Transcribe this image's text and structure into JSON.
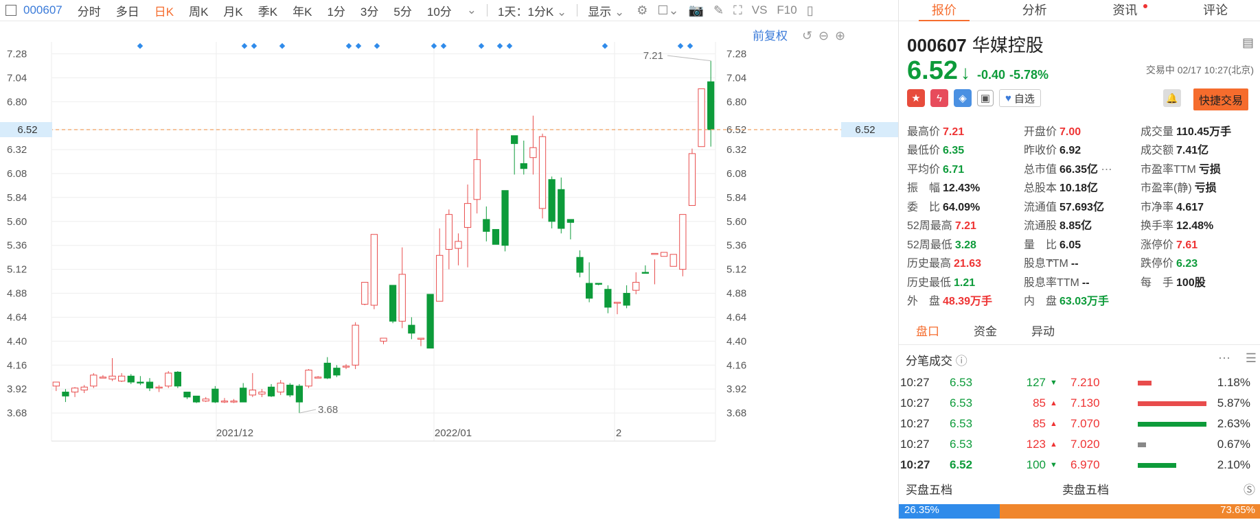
{
  "toolbar": {
    "code": "000607",
    "items": [
      "分时",
      "多日",
      "日K",
      "周K",
      "月K",
      "季K",
      "年K",
      "1分",
      "3分",
      "5分",
      "10分"
    ],
    "active": "日K",
    "period_select": "1天：1分K",
    "display_label": "显示",
    "f10": "F10"
  },
  "chart": {
    "restore_label": "前复权",
    "current_price_label": "6.52",
    "high_label": "7.21",
    "low_label": "3.68",
    "colors": {
      "up": "#e84c4c",
      "down": "#0d9b3a",
      "ref_line": "#f0a060",
      "grid": "#eeeeee",
      "marker": "#2f8bea"
    }
  },
  "chart_data": {
    "type": "candlestick",
    "ylim": [
      3.55,
      7.4
    ],
    "yticks": [
      "7.28",
      "7.04",
      "6.80",
      "6.52",
      "6.32",
      "6.08",
      "5.84",
      "5.60",
      "5.36",
      "5.12",
      "4.88",
      "4.64",
      "4.40",
      "4.16",
      "3.92",
      "3.68"
    ],
    "xtick_labels": [
      "2021/12",
      "2022/01",
      "2"
    ],
    "candles": [
      [
        3.95,
        3.99,
        3.9,
        3.98
      ],
      [
        3.89,
        3.85,
        3.79,
        3.92
      ],
      [
        3.89,
        3.93,
        3.84,
        3.94
      ],
      [
        3.91,
        3.94,
        3.88,
        3.96
      ],
      [
        3.95,
        4.06,
        3.93,
        4.08
      ],
      [
        4.04,
        4.04,
        4.03,
        4.06
      ],
      [
        4.02,
        4.05,
        4.0,
        4.23
      ],
      [
        4.0,
        4.05,
        3.99,
        4.08
      ],
      [
        4.05,
        3.99,
        3.97,
        4.07
      ],
      [
        3.99,
        3.98,
        3.96,
        4.05
      ],
      [
        3.99,
        3.93,
        3.9,
        4.03
      ],
      [
        3.93,
        3.94,
        3.89,
        3.96
      ],
      [
        3.95,
        4.08,
        3.93,
        4.1
      ],
      [
        4.09,
        3.95,
        3.93,
        4.1
      ],
      [
        3.89,
        3.84,
        3.82,
        3.89
      ],
      [
        3.85,
        3.79,
        3.78,
        3.85
      ],
      [
        3.8,
        3.82,
        3.79,
        3.84
      ],
      [
        3.92,
        3.79,
        3.78,
        3.95
      ],
      [
        3.8,
        3.8,
        3.78,
        3.83
      ],
      [
        3.79,
        3.8,
        3.78,
        3.82
      ],
      [
        3.93,
        3.79,
        3.79,
        3.98
      ],
      [
        3.86,
        3.91,
        3.84,
        4.08
      ],
      [
        3.87,
        3.89,
        3.84,
        3.92
      ],
      [
        3.94,
        3.85,
        3.84,
        3.97
      ],
      [
        3.89,
        3.98,
        3.86,
        4.01
      ],
      [
        3.96,
        3.86,
        3.84,
        3.98
      ],
      [
        3.95,
        3.79,
        3.68,
        3.97
      ],
      [
        3.95,
        4.11,
        3.93,
        4.12
      ],
      [
        4.03,
        4.04,
        4.03,
        4.05
      ],
      [
        4.18,
        4.03,
        4.02,
        4.24
      ],
      [
        4.13,
        4.06,
        4.04,
        4.16
      ],
      [
        4.14,
        4.15,
        4.12,
        4.17
      ],
      [
        4.16,
        4.56,
        4.12,
        4.59
      ],
      [
        4.77,
        4.99,
        4.76,
        4.99
      ],
      [
        4.76,
        5.47,
        4.72,
        5.47
      ],
      [
        4.4,
        4.43,
        4.37,
        4.43
      ],
      [
        4.96,
        4.6,
        4.58,
        4.63
      ],
      [
        4.6,
        5.07,
        4.53,
        5.34
      ],
      [
        4.56,
        4.48,
        4.42,
        4.64
      ],
      [
        4.43,
        4.43,
        4.35,
        4.43
      ],
      [
        4.87,
        4.33,
        4.34,
        4.87
      ],
      [
        4.8,
        5.26,
        4.92,
        5.53
      ],
      [
        5.32,
        5.67,
        5.12,
        5.72
      ],
      [
        5.33,
        5.4,
        5.16,
        5.48
      ],
      [
        5.54,
        5.78,
        5.14,
        5.97
      ],
      [
        5.82,
        6.22,
        5.68,
        6.53
      ],
      [
        5.62,
        5.5,
        5.4,
        5.75
      ],
      [
        5.52,
        5.37,
        5.37,
        5.52
      ],
      [
        5.91,
        5.36,
        5.3,
        5.91
      ],
      [
        6.46,
        6.38,
        6.07,
        6.38
      ],
      [
        6.18,
        6.13,
        6.07,
        6.41
      ],
      [
        6.24,
        6.34,
        6.07,
        6.66
      ],
      [
        5.73,
        6.45,
        5.63,
        6.48
      ],
      [
        6.02,
        5.6,
        5.53,
        6.05
      ],
      [
        5.92,
        5.53,
        5.48,
        6.04
      ],
      [
        5.62,
        5.59,
        5.42,
        5.59
      ],
      [
        5.24,
        5.09,
        5.04,
        5.31
      ],
      [
        4.98,
        4.83,
        4.79,
        5.19
      ],
      [
        4.98,
        4.97,
        4.96,
        4.97
      ],
      [
        4.92,
        4.74,
        4.68,
        4.96
      ],
      [
        4.79,
        4.79,
        4.67,
        4.79
      ],
      [
        4.88,
        4.76,
        4.73,
        4.96
      ],
      [
        4.91,
        4.99,
        4.87,
        5.09
      ],
      [
        5.09,
        5.08,
        5.08,
        5.16
      ],
      [
        5.28,
        5.28,
        4.97,
        5.22
      ],
      [
        5.25,
        5.29,
        5.25,
        5.25
      ],
      [
        5.15,
        5.27,
        5.15,
        5.24
      ],
      [
        5.12,
        5.67,
        5.05,
        5.67
      ],
      [
        5.76,
        6.28,
        5.76,
        6.33
      ],
      [
        6.35,
        6.93,
        6.38,
        6.93
      ],
      [
        7.0,
        6.52,
        6.35,
        7.21
      ]
    ]
  },
  "quote": {
    "tabs": [
      "报价",
      "分析",
      "资讯",
      "评论"
    ],
    "code": "000607",
    "name": "华媒控股",
    "price": "6.52",
    "change": "-0.40",
    "change_pct": "-5.78%",
    "status": "交易中 02/17 10:27(北京)",
    "watch_label": "自选",
    "quick_trade": "快捷交易",
    "stats": [
      [
        [
          "最高价",
          "7.21",
          "red"
        ],
        [
          "开盘价",
          "7.00",
          "red"
        ],
        [
          "成交量",
          "110.45万手",
          ""
        ]
      ],
      [
        [
          "最低价",
          "6.35",
          "green"
        ],
        [
          "昨收价",
          "6.92",
          ""
        ],
        [
          "成交额",
          "7.41亿",
          ""
        ]
      ],
      [
        [
          "平均价",
          "6.71",
          "green"
        ],
        [
          "总市值",
          "66.35亿",
          ""
        ],
        [
          "市盈率TTM",
          "亏损",
          ""
        ]
      ],
      [
        [
          "振　幅",
          "12.43%",
          ""
        ],
        [
          "总股本",
          "10.18亿",
          ""
        ],
        [
          "市盈率(静)",
          "亏损",
          ""
        ]
      ],
      [
        [
          "委　比",
          "64.09%",
          ""
        ],
        [
          "流通值",
          "57.693亿",
          ""
        ],
        [
          "市净率",
          "4.617",
          ""
        ]
      ],
      [
        [
          "52周最高",
          "7.21",
          "red"
        ],
        [
          "流通股",
          "8.85亿",
          ""
        ],
        [
          "换手率",
          "12.48%",
          ""
        ]
      ],
      [
        [
          "52周最低",
          "3.28",
          "green"
        ],
        [
          "量　比",
          "6.05",
          ""
        ],
        [
          "涨停价",
          "7.61",
          "red"
        ]
      ],
      [
        [
          "历史最高",
          "21.63",
          "red"
        ],
        [
          "股息TTM",
          "--",
          ""
        ],
        [
          "跌停价",
          "6.23",
          "green"
        ]
      ],
      [
        [
          "历史最低",
          "1.21",
          "green"
        ],
        [
          "股息率TTM",
          "--",
          ""
        ],
        [
          "每　手",
          "100股",
          ""
        ]
      ],
      [
        [
          "外　盘",
          "48.39万手",
          "red"
        ],
        [
          "内　盘",
          "63.03万手",
          "green"
        ],
        [
          "",
          "",
          " "
        ]
      ]
    ],
    "subtabs": [
      "盘口",
      "资金",
      "异动"
    ],
    "tick_title": "分笔成交",
    "ticks": [
      [
        "10:27",
        "6.53",
        "127",
        "down"
      ],
      [
        "10:27",
        "6.53",
        "85",
        "up"
      ],
      [
        "10:27",
        "6.53",
        "85",
        "up"
      ],
      [
        "10:27",
        "6.53",
        "123",
        "up"
      ],
      [
        "10:27",
        "6.52",
        "100",
        "down"
      ]
    ],
    "depth": [
      [
        "7.210",
        "1.18%",
        "#e84c4c",
        0.1
      ],
      [
        "7.130",
        "5.87%",
        "#e84c4c",
        0.5
      ],
      [
        "7.070",
        "2.63%",
        "#0d9b3a",
        0.5
      ],
      [
        "7.020",
        "0.67%",
        "#888888",
        0.06
      ],
      [
        "6.970",
        "2.10%",
        "#0d9b3a",
        0.28
      ]
    ],
    "buy_label": "买盘五档",
    "sell_label": "卖盘五档",
    "buy_pct": "26.35%",
    "sell_pct": "73.65%",
    "buy_ratio": 0.2635
  }
}
